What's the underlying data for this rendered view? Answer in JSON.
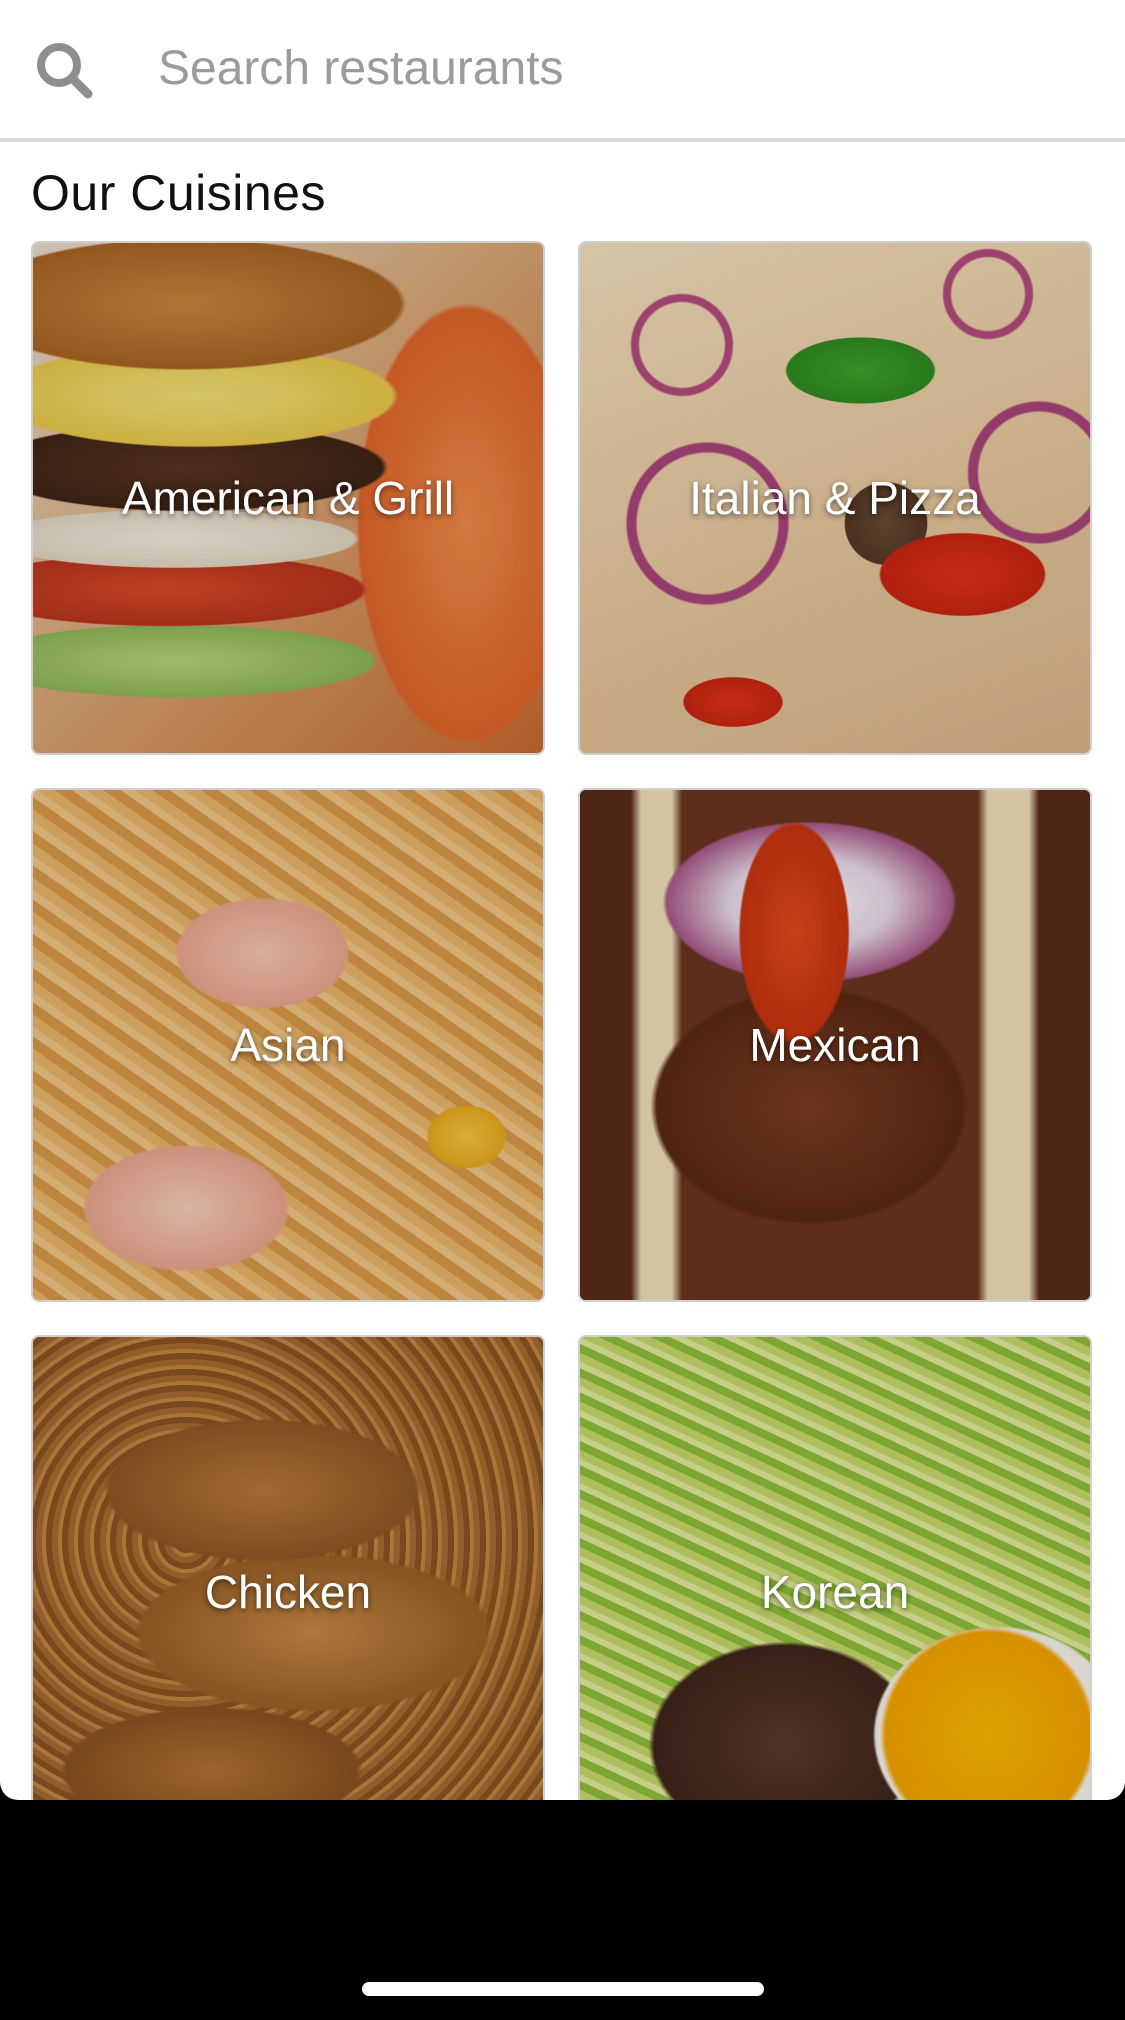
{
  "search": {
    "placeholder": "Search restaurants",
    "value": ""
  },
  "section": {
    "title": "Our Cuisines"
  },
  "cuisines": [
    {
      "label": "American & Grill"
    },
    {
      "label": "Italian & Pizza"
    },
    {
      "label": "Asian"
    },
    {
      "label": "Mexican"
    },
    {
      "label": "Chicken"
    },
    {
      "label": "Korean"
    }
  ],
  "icons": {
    "search": "search-icon"
  },
  "colors": {
    "placeholder": "#9b9b9b",
    "divider": "#d9d9d9",
    "tile_border": "#cfcfcf",
    "label_text": "#ffffff",
    "background": "#ffffff",
    "system_bar": "#000000"
  }
}
